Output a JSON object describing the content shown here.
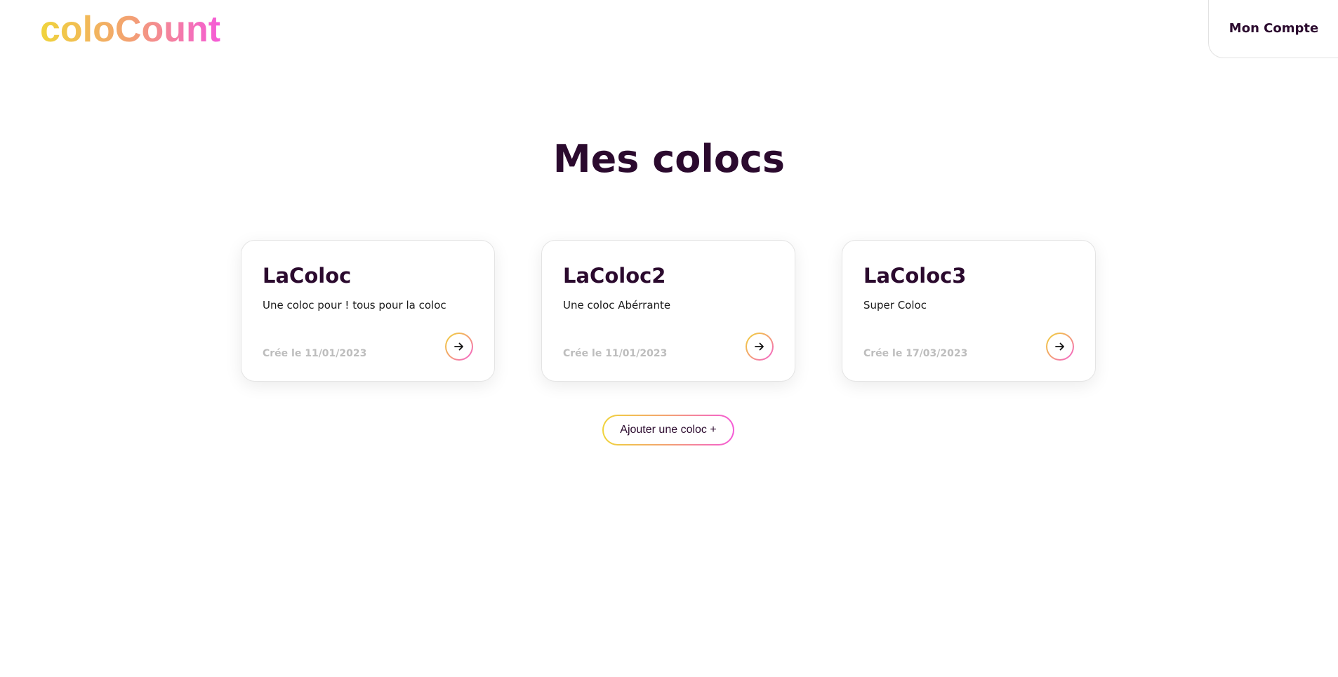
{
  "header": {
    "logo_text": "coloCount",
    "account_label": "Mon Compte"
  },
  "main": {
    "title": "Mes colocs",
    "colocs": [
      {
        "name": "LaColoc",
        "description": "Une coloc pour ! tous pour la coloc",
        "created": "Crée le 11/01/2023",
        "open_icon": "arrow-right-icon"
      },
      {
        "name": "LaColoc2",
        "description": "Une coloc Abérrante",
        "created": "Crée le 11/01/2023",
        "open_icon": "arrow-right-icon"
      },
      {
        "name": "LaColoc3",
        "description": "Super Coloc",
        "created": "Crée le 17/03/2023",
        "open_icon": "arrow-right-icon"
      }
    ],
    "add_label": "Ajouter une coloc +"
  },
  "colors": {
    "primary_text": "#2b0a2e",
    "gradient_start": "#f0d43c",
    "gradient_mid": "#f3a172",
    "gradient_end": "#f55ad8",
    "muted_text": "#bdbdbd"
  }
}
